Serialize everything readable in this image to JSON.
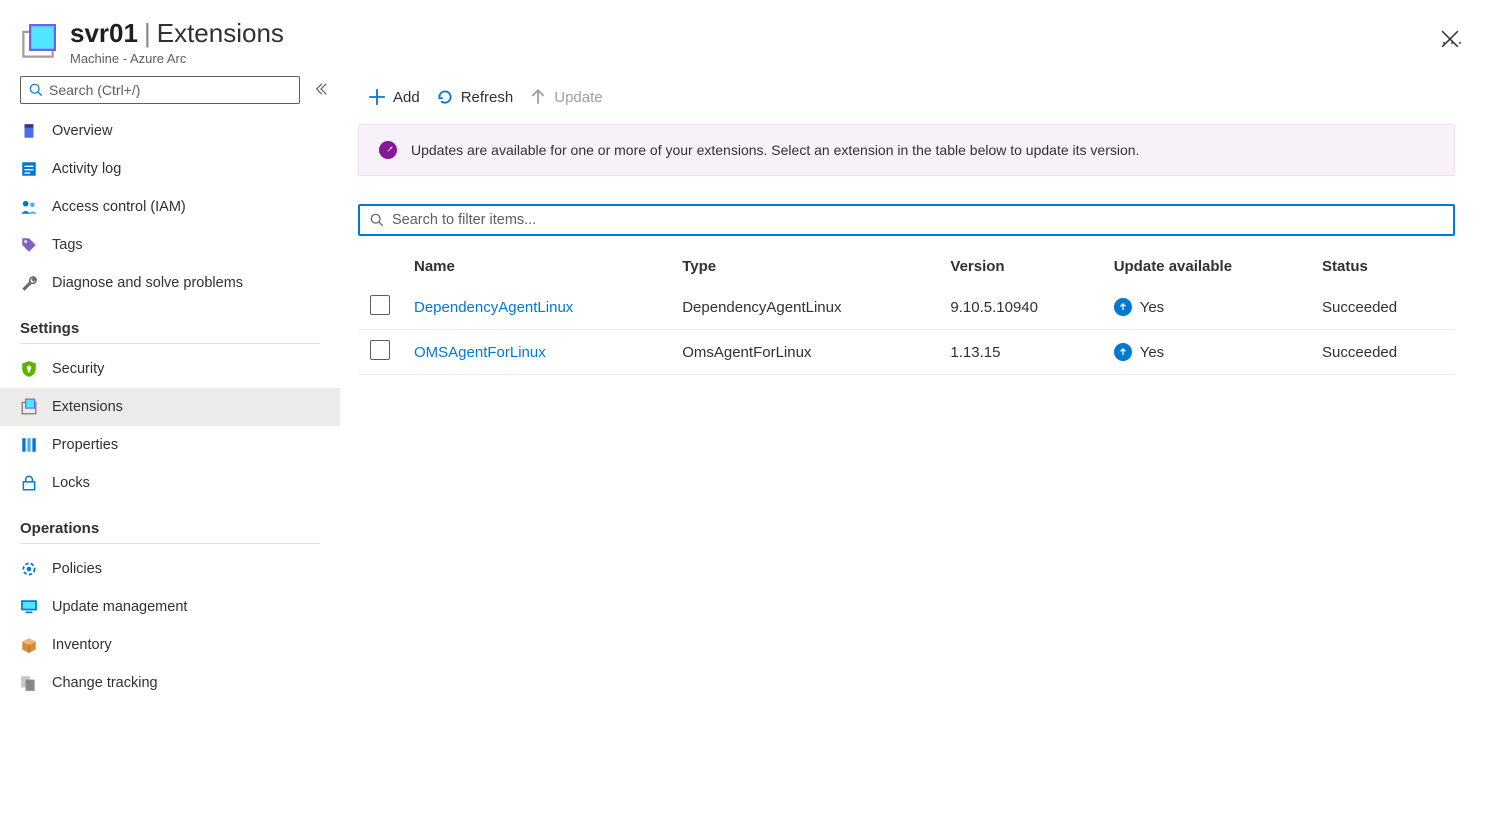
{
  "header": {
    "resource_name": "svr01",
    "section": "Extensions",
    "subtitle": "Machine - Azure Arc"
  },
  "sidebar_search_placeholder": "Search (Ctrl+/)",
  "sidebar": {
    "items_top": [
      {
        "label": "Overview",
        "icon": "server-icon"
      },
      {
        "label": "Activity log",
        "icon": "log-icon"
      },
      {
        "label": "Access control (IAM)",
        "icon": "people-icon"
      },
      {
        "label": "Tags",
        "icon": "tag-icon"
      },
      {
        "label": "Diagnose and solve problems",
        "icon": "wrench-icon"
      }
    ],
    "sections": [
      {
        "title": "Settings",
        "items": [
          {
            "label": "Security",
            "icon": "shield-icon"
          },
          {
            "label": "Extensions",
            "icon": "extensions-icon",
            "active": true
          },
          {
            "label": "Properties",
            "icon": "properties-icon"
          },
          {
            "label": "Locks",
            "icon": "lock-icon"
          }
        ]
      },
      {
        "title": "Operations",
        "items": [
          {
            "label": "Policies",
            "icon": "policy-icon"
          },
          {
            "label": "Update management",
            "icon": "monitor-icon"
          },
          {
            "label": "Inventory",
            "icon": "box-icon"
          },
          {
            "label": "Change tracking",
            "icon": "changes-icon"
          }
        ]
      }
    ]
  },
  "toolbar": {
    "add": "Add",
    "refresh": "Refresh",
    "update": "Update"
  },
  "notice": "Updates are available for one or more of your extensions. Select an extension in the table below to update its version.",
  "filter_placeholder": "Search to filter items...",
  "table": {
    "columns": [
      "Name",
      "Type",
      "Version",
      "Update available",
      "Status"
    ],
    "rows": [
      {
        "name": "DependencyAgentLinux",
        "type": "DependencyAgentLinux",
        "version": "9.10.5.10940",
        "update": "Yes",
        "status": "Succeeded"
      },
      {
        "name": "OMSAgentForLinux",
        "type": "OmsAgentForLinux",
        "version": "1.13.15",
        "update": "Yes",
        "status": "Succeeded"
      }
    ]
  }
}
